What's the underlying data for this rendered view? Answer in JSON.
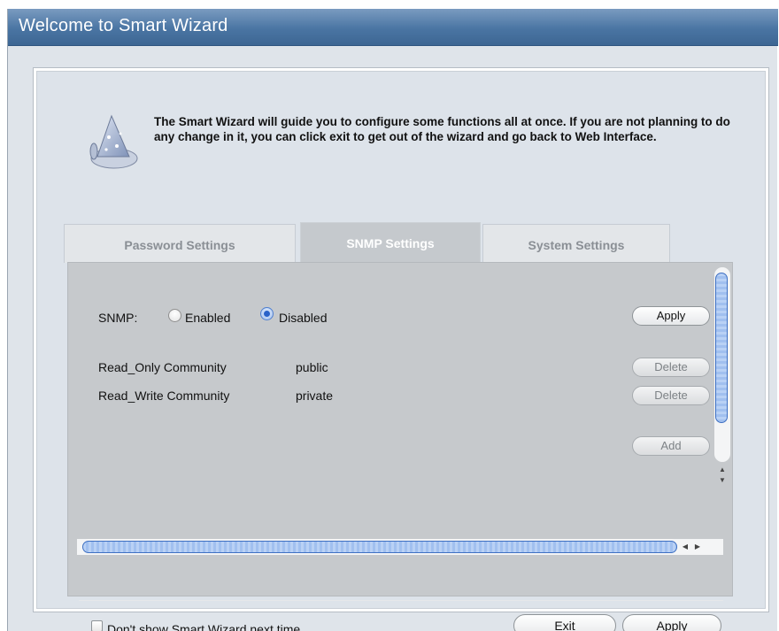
{
  "window": {
    "title": "Welcome to Smart Wizard"
  },
  "intro": {
    "text": "The Smart Wizard will guide you to configure some functions all at once. If you are not planning to do any change in it, you can click exit to get out of the wizard and go back to Web Interface.",
    "icon": "wizard-hat-icon"
  },
  "tabs": [
    {
      "label": "Password Settings",
      "active": false
    },
    {
      "label": "SNMP Settings",
      "active": true
    },
    {
      "label": "System Settings",
      "active": false
    }
  ],
  "snmp": {
    "label": "SNMP:",
    "options": [
      {
        "label": "Enabled",
        "selected": false
      },
      {
        "label": "Disabled",
        "selected": true
      }
    ],
    "apply_label": "Apply"
  },
  "communities": [
    {
      "name": "Read_Only Community",
      "value": "public",
      "action": "Delete"
    },
    {
      "name": "Read_Write Community",
      "value": "private",
      "action": "Delete"
    }
  ],
  "add_label": "Add",
  "footer": {
    "checkbox_label": "Don't show Smart Wizard next time",
    "checkbox_checked": false,
    "exit_label": "Exit",
    "apply_label": "Apply"
  },
  "colors": {
    "titlebar": "#4a75a3",
    "scroll_thumb": "#a1c0ef",
    "radio_selected": "#2a62c9"
  }
}
